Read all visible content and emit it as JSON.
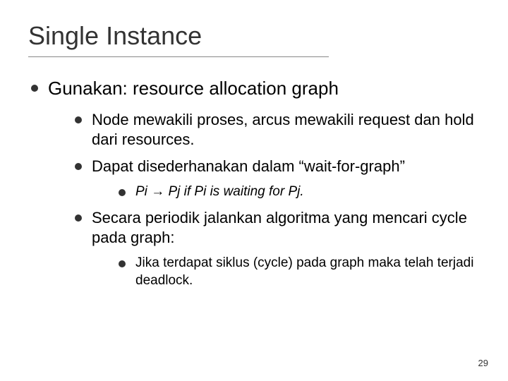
{
  "title": "Single Instance",
  "lvl0": {
    "text": "Gunakan: resource allocation graph"
  },
  "lvl1": {
    "a": "Node mewakili proses, arcus mewakili request dan hold dari resources.",
    "b": "Dapat disederhanakan dalam “wait-for-graph”",
    "c": "Secara periodik jalankan algoritma yang mencari cycle pada graph:"
  },
  "lvl2": {
    "a_pi": "Pi ",
    "a_arrow": "→",
    "a_rest": " Pj if Pi is waiting for Pj.",
    "b": "Jika terdapat siklus (cycle) pada graph maka telah terjadi deadlock."
  },
  "pagenum": "29"
}
